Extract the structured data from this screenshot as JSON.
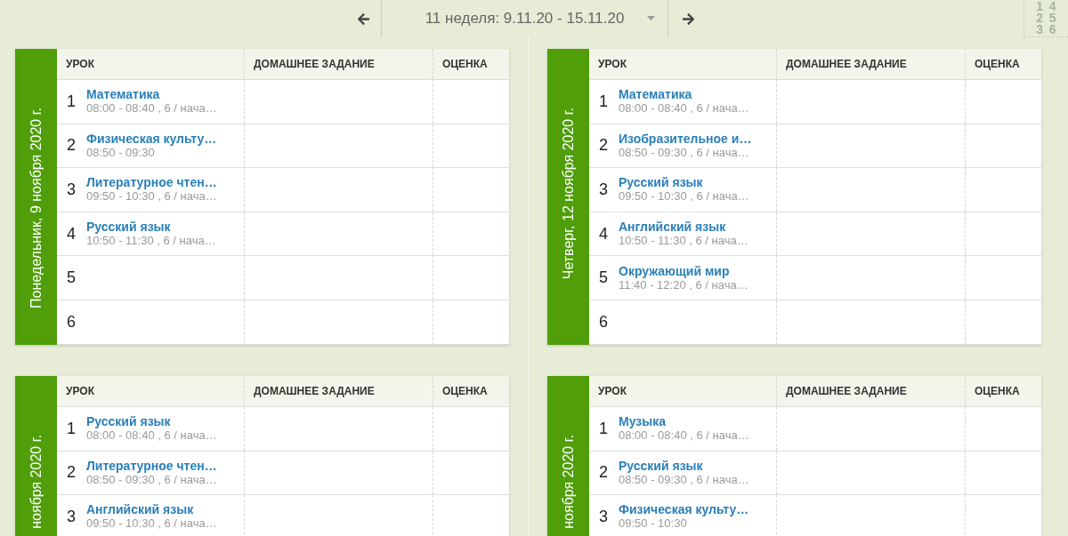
{
  "week_nav": {
    "week": "11 неделя: 9.11.20 - 15.11.20"
  },
  "layout_toggle": {
    "digits": [
      "1",
      "4",
      "2",
      "5",
      "3",
      "6"
    ]
  },
  "days": [
    {
      "label": "Понедельник, 9 ноября 2020 г.",
      "columns": [
        "УРОК",
        "ДОМАШНЕЕ ЗАДАНИЕ",
        "ОЦЕНКА"
      ],
      "lessons": [
        {
          "number": "1",
          "subject": "Математика",
          "details": "08:00 - 08:40 , 6 / нача…"
        },
        {
          "number": "2",
          "subject": "Физическая культу…",
          "details": "08:50 - 09:30"
        },
        {
          "number": "3",
          "subject": "Литературное чтен…",
          "details": "09:50 - 10:30 , 6 / нача…"
        },
        {
          "number": "4",
          "subject": "Русский язык",
          "details": "10:50 - 11:30 , 6 / нача…"
        },
        {
          "number": "5"
        },
        {
          "number": "6"
        }
      ]
    },
    {
      "label": "Четверг, 12 ноября 2020 г.",
      "columns": [
        "УРОК",
        "ДОМАШНЕЕ ЗАДАНИЕ",
        "ОЦЕНКА"
      ],
      "lessons": [
        {
          "number": "1",
          "subject": "Математика",
          "details": "08:00 - 08:40 , 6 / нача…"
        },
        {
          "number": "2",
          "subject": "Изобразительное и…",
          "details": "08:50 - 09:30 , 6 / нача…"
        },
        {
          "number": "3",
          "subject": "Русский язык",
          "details": "09:50 - 10:30 , 6 / нача…"
        },
        {
          "number": "4",
          "subject": "Английский язык",
          "details": "10:50 - 11:30 , 6 / нача…"
        },
        {
          "number": "5",
          "subject": "Окружающий мир",
          "details": "11:40 - 12:20 , 6 / нача…"
        },
        {
          "number": "6"
        }
      ]
    },
    {
      "label": "ноября 2020 г.",
      "columns": [
        "УРОК",
        "ДОМАШНЕЕ ЗАДАНИЕ",
        "ОЦЕНКА"
      ],
      "lessons": [
        {
          "number": "1",
          "subject": "Русский язык",
          "details": "08:00 - 08:40 , 6 / нача…"
        },
        {
          "number": "2",
          "subject": "Литературное чтен…",
          "details": "08:50 - 09:30 , 6 / нача…"
        },
        {
          "number": "3",
          "subject": "Английский язык",
          "details": "09:50 - 10:30 , 6 / нача…"
        }
      ]
    },
    {
      "label": "ноября 2020 г.",
      "columns": [
        "УРОК",
        "ДОМАШНЕЕ ЗАДАНИЕ",
        "ОЦЕНКА"
      ],
      "lessons": [
        {
          "number": "1",
          "subject": "Музыка",
          "details": "08:00 - 08:40 , 6 / нача…"
        },
        {
          "number": "2",
          "subject": "Русский язык",
          "details": "08:50 - 09:30 , 6 / нача…"
        },
        {
          "number": "3",
          "subject": "Физическая культу…",
          "details": "09:50 - 10:30"
        }
      ]
    }
  ]
}
